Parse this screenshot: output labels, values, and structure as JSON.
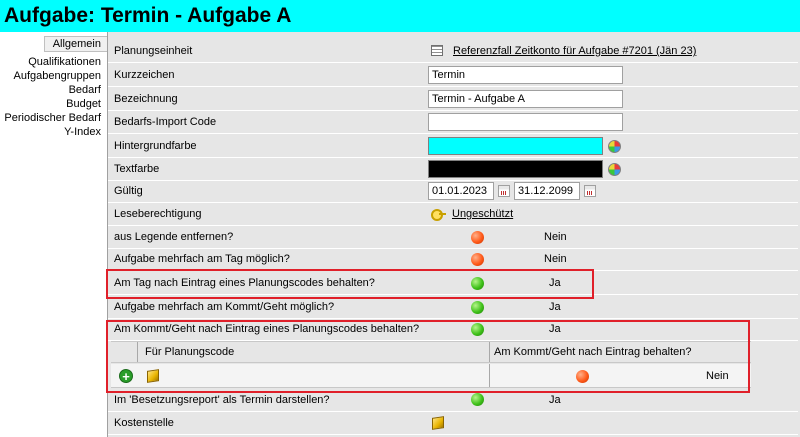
{
  "title": "Aufgabe: Termin - Aufgabe A",
  "sidebar": {
    "items": [
      {
        "label": "Allgemein",
        "active": true
      },
      {
        "label": "Qualifikationen"
      },
      {
        "label": "Aufgabengruppen"
      },
      {
        "label": "Bedarf"
      },
      {
        "label": "Budget"
      },
      {
        "label": "Periodischer Bedarf"
      },
      {
        "label": "Y-Index"
      }
    ]
  },
  "form": {
    "planungseinheit": {
      "label": "Planungseinheit",
      "value": "Referenzfall Zeitkonto für Aufgabe #7201 (Jän 23)"
    },
    "kurzzeichen": {
      "label": "Kurzzeichen",
      "value": "Termin"
    },
    "bezeichnung": {
      "label": "Bezeichnung",
      "value": "Termin - Aufgabe A"
    },
    "bedarfs_import_code": {
      "label": "Bedarfs-Import Code",
      "value": ""
    },
    "hintergrundfarbe": {
      "label": "Hintergrundfarbe",
      "color": "#00ffff"
    },
    "textfarbe": {
      "label": "Textfarbe",
      "color": "#000000"
    },
    "gueltig": {
      "label": "Gültig",
      "from": "01.01.2023",
      "to": "31.12.2099"
    },
    "leseberechtigung": {
      "label": "Leseberechtigung",
      "value": "Ungeschützt"
    },
    "aus_legende": {
      "label": "aus Legende entfernen?",
      "value": "Nein",
      "status": "red"
    },
    "mehrfach_tag": {
      "label": "Aufgabe mehrfach am Tag möglich?",
      "value": "Nein",
      "status": "red"
    },
    "am_tag_nach": {
      "label": "Am Tag nach Eintrag eines Planungscodes behalten?",
      "value": "Ja",
      "status": "green"
    },
    "mehrfach_kommt": {
      "label": "Aufgabe mehrfach am Kommt/Geht möglich?",
      "value": "Ja",
      "status": "green"
    },
    "am_kommt_nach": {
      "label": "Am Kommt/Geht nach Eintrag eines Planungscodes behalten?",
      "value": "Ja",
      "status": "green"
    },
    "subgrid": {
      "col1": "Für Planungscode",
      "col2": "Am Kommt/Geht nach Eintrag behalten?",
      "row_value": "Nein",
      "row_status": "red"
    },
    "besetzungsreport": {
      "label": "Im 'Besetzungsreport' als Termin darstellen?",
      "value": "Ja",
      "status": "green"
    },
    "kostenstelle": {
      "label": "Kostenstelle"
    }
  },
  "colors": {
    "title_bg": "#00ffff",
    "highlight_border": "#e0202a",
    "status_red": "#ff5a1a",
    "status_green": "#3fc11a"
  }
}
